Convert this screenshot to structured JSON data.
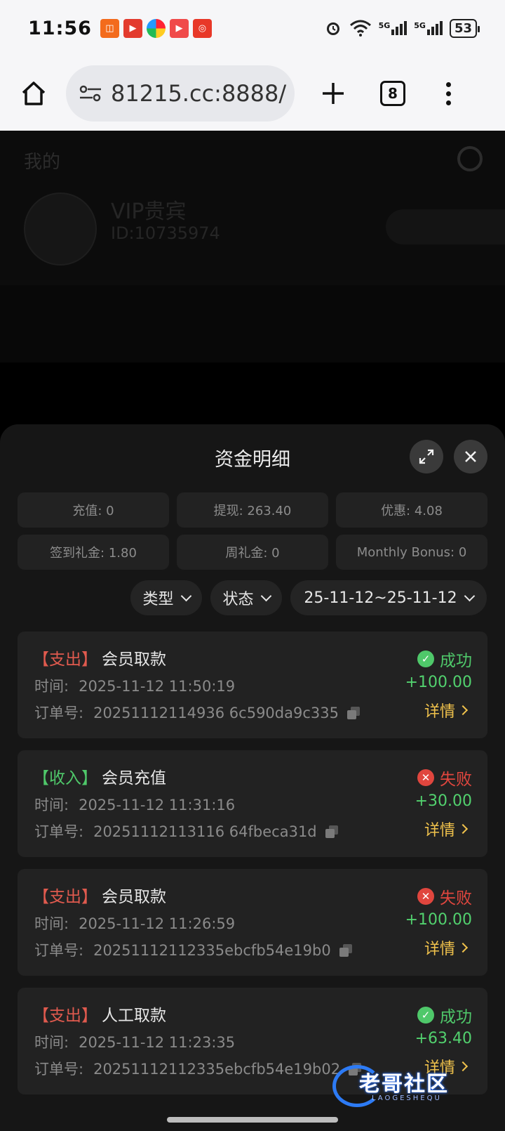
{
  "status_bar": {
    "time": "11:56",
    "battery": "53",
    "network_1": "5G",
    "network_2": "5G"
  },
  "browser": {
    "url": "81215.cc:8888/",
    "tab_count": "8"
  },
  "background_page": {
    "title": "我的",
    "vip": "VIP贵宾",
    "id": "ID:10735974"
  },
  "sheet": {
    "title": "资金明细",
    "summary": [
      "充值: 0",
      "提现: 263.40",
      "优惠: 4.08",
      "签到礼金: 1.80",
      "周礼金: 0",
      "Monthly Bonus: 0"
    ],
    "filters": {
      "type": "类型",
      "status": "状态",
      "date_range": "25-11-12~25-11-12"
    },
    "time_label": "时间:",
    "order_label": "订单号:",
    "detail_label": "详情",
    "records": [
      {
        "direction": "【支出】",
        "kind": "会员取款",
        "time": "2025-11-12 11:50:19",
        "order": "20251112114936 6c590da9c335",
        "status": "成功",
        "amount": "+100.00"
      },
      {
        "direction": "【收入】",
        "kind": "会员充值",
        "time": "2025-11-12 11:31:16",
        "order": "20251112113116 64fbeca31d",
        "status": "失败",
        "amount": "+30.00"
      },
      {
        "direction": "【支出】",
        "kind": "会员取款",
        "time": "2025-11-12 11:26:59",
        "order": "20251112112335ebcfb54e19b0",
        "status": "失败",
        "amount": "+100.00"
      },
      {
        "direction": "【支出】",
        "kind": "人工取款",
        "time": "2025-11-12 11:23:35",
        "order": "20251112112335ebcfb54e19b02",
        "status": "成功",
        "amount": "+63.40"
      }
    ]
  },
  "watermark": {
    "text": "老哥社区",
    "sub": "LAOGESHEQU"
  },
  "colors": {
    "expense": "#e05a4e",
    "income": "#4fc86a",
    "success": "#4fc86a",
    "fail": "#e0463e",
    "amount": "#52d16e",
    "detail": "#f0c24c"
  }
}
